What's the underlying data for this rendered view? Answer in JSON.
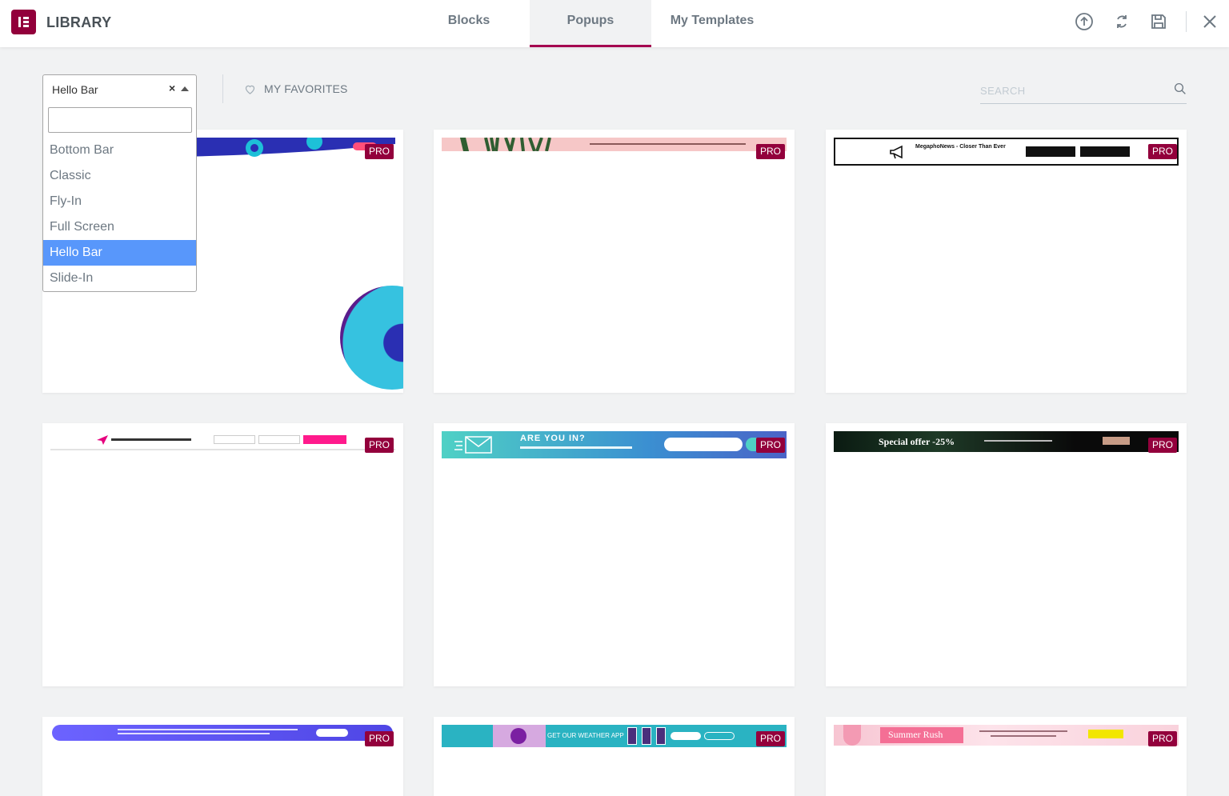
{
  "header": {
    "brand": "LIBRARY",
    "tabs": [
      {
        "label": "Blocks",
        "active": false
      },
      {
        "label": "Popups",
        "active": true
      },
      {
        "label": "My Templates",
        "active": false
      }
    ],
    "tools": [
      "upload-icon",
      "sync-icon",
      "save-icon",
      "close-icon"
    ]
  },
  "filter": {
    "selected": "Hello Bar",
    "clear_symbol": "×",
    "options": [
      "Bottom Bar",
      "Classic",
      "Fly-In",
      "Full Screen",
      "Hello Bar",
      "Slide-In"
    ],
    "selected_index": 4
  },
  "favorites": {
    "label": "MY FAVORITES"
  },
  "search": {
    "placeholder": "SEARCH"
  },
  "templates": {
    "badge": "PRO",
    "items": [
      {
        "title": "",
        "accent": "#2a2fb3"
      },
      {
        "title": "",
        "accent": "#f6c7c7"
      },
      {
        "title": "MegaphoNews - Closer Than Ever",
        "accent": "#ffffff"
      },
      {
        "title": "",
        "accent": "#ffffff"
      },
      {
        "title": "ARE YOU IN?",
        "accent": "#4fd1c5"
      },
      {
        "title": "Special offer -25%",
        "accent": "#0b1b12"
      },
      {
        "title": "",
        "accent": "#6c63ff"
      },
      {
        "title": "GET OUR WEATHER APP",
        "accent": "#2ab3c2"
      },
      {
        "title": "Summer Rush",
        "accent": "#f7c5d2"
      }
    ]
  },
  "colors": {
    "brand": "#92003b",
    "active_tab_border": "#a4004f",
    "pro_badge": "#93003c",
    "dropdown_selected": "#5897fb"
  }
}
